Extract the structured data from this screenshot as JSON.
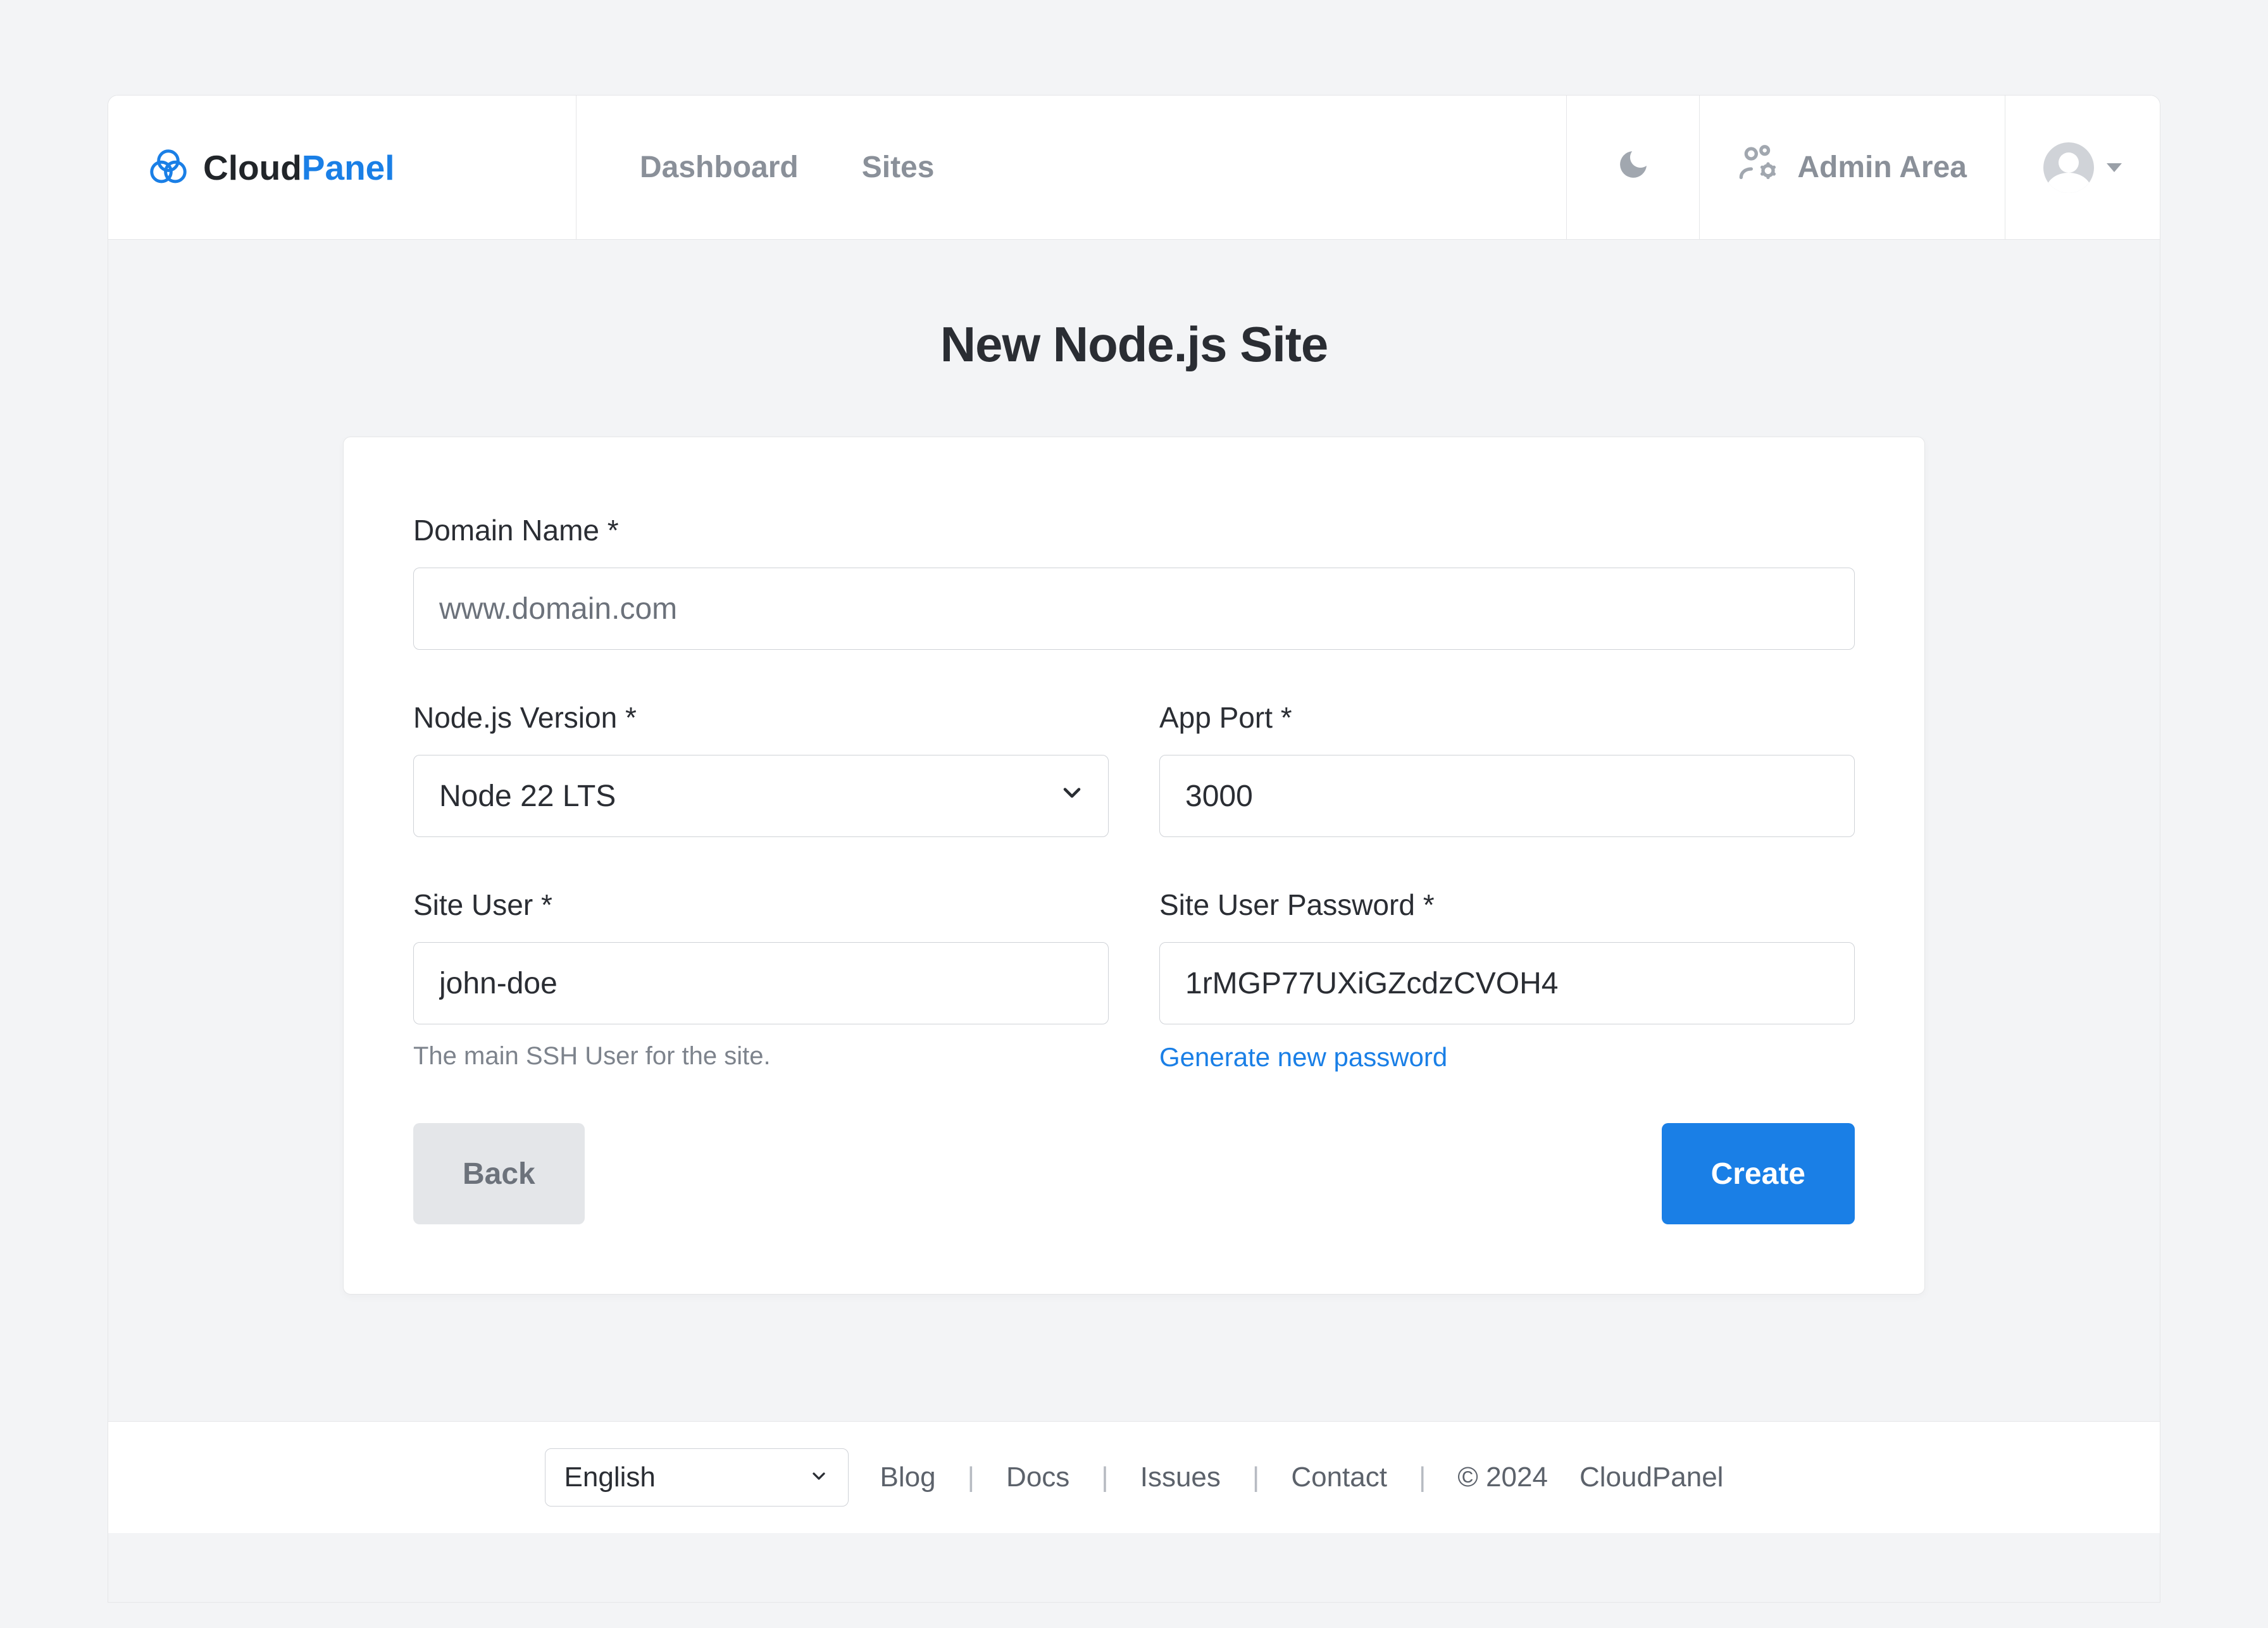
{
  "brand": {
    "part1": "Cloud",
    "part2": "Panel"
  },
  "nav": {
    "dashboard": "Dashboard",
    "sites": "Sites",
    "admin_area": "Admin Area"
  },
  "page": {
    "title": "New Node.js Site"
  },
  "form": {
    "domain": {
      "label": "Domain Name *",
      "placeholder": "www.domain.com",
      "value": ""
    },
    "nodejs_version": {
      "label": "Node.js Version *",
      "value": "Node 22 LTS"
    },
    "app_port": {
      "label": "App Port *",
      "value": "3000"
    },
    "site_user": {
      "label": "Site User *",
      "value": "john-doe",
      "hint": "The main SSH User for the site."
    },
    "site_user_password": {
      "label": "Site User Password *",
      "value": "1rMGP77UXiGZcdzCVOH4",
      "generate_link": "Generate new password"
    },
    "buttons": {
      "back": "Back",
      "create": "Create"
    }
  },
  "footer": {
    "language": "English",
    "links": {
      "blog": "Blog",
      "docs": "Docs",
      "issues": "Issues",
      "contact": "Contact"
    },
    "copyright": "© 2024",
    "brand": "CloudPanel"
  }
}
